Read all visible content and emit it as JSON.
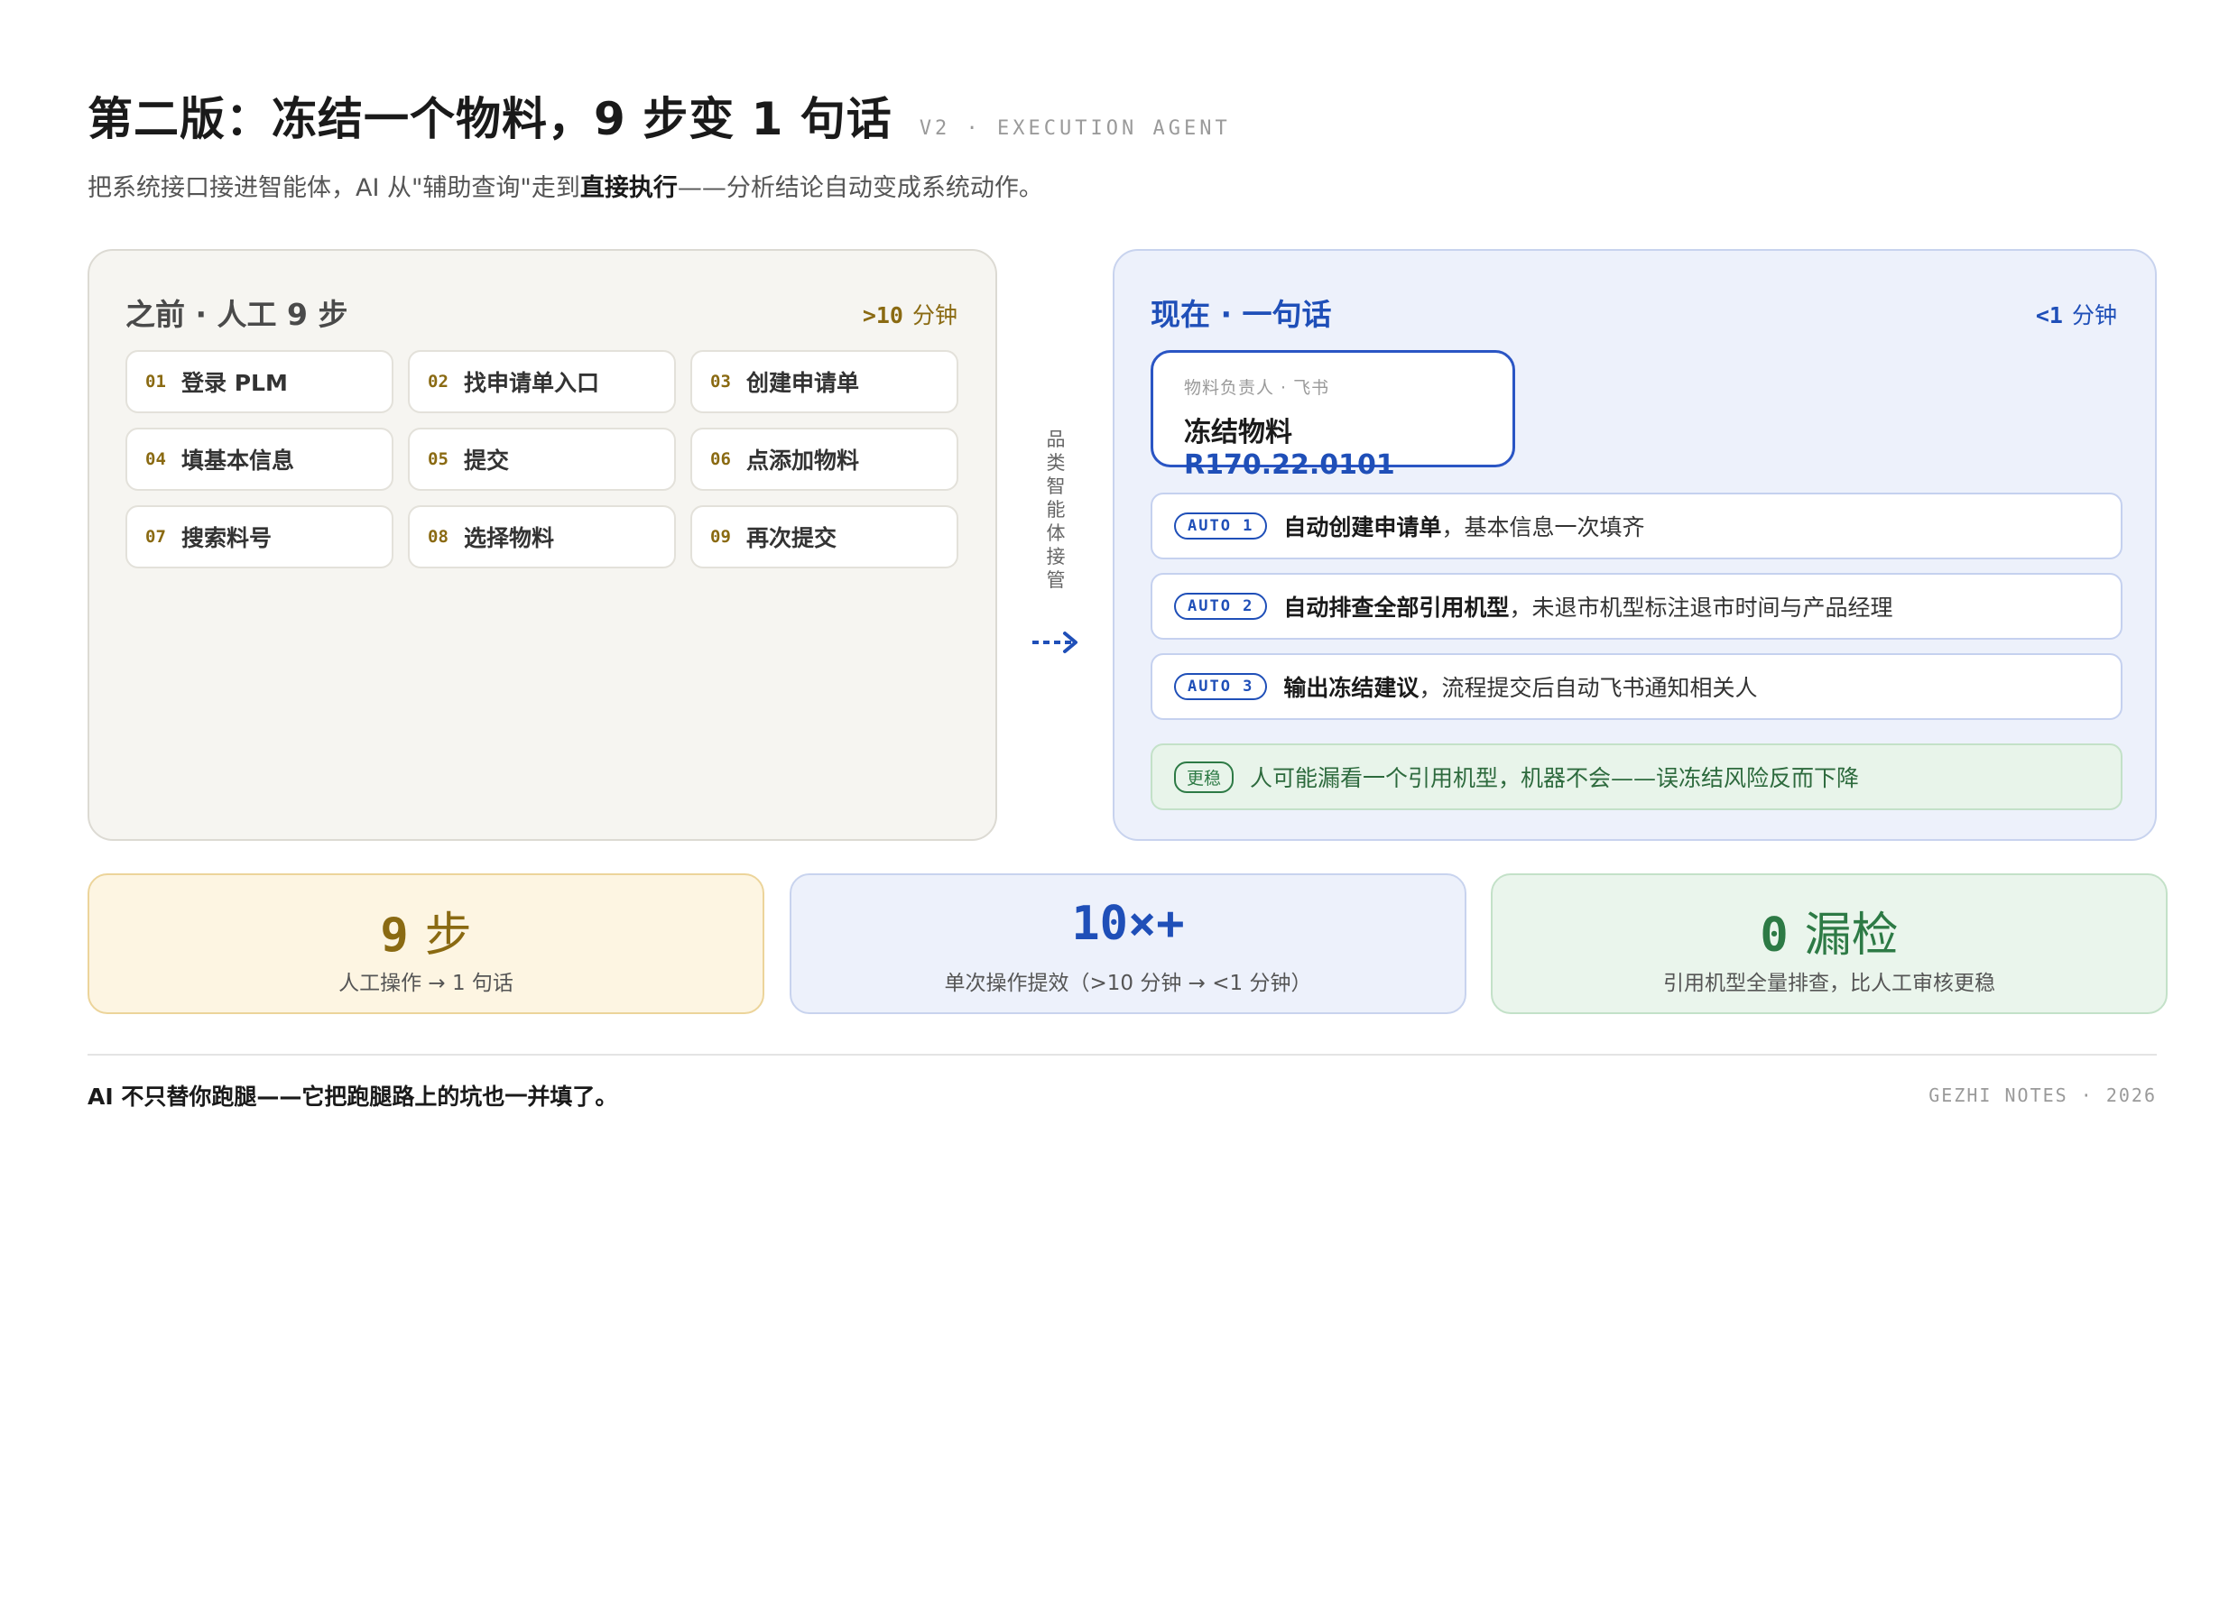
{
  "header": {
    "title": "第二版：冻结一个物料，9 步变 1 句话",
    "tag": "V2 · EXECUTION AGENT",
    "subtitle_pre": "把系统接口接进智能体，AI 从\"辅助查询\"走到",
    "subtitle_bold": "直接执行",
    "subtitle_post": "——分析结论自动变成系统动作。"
  },
  "before": {
    "heading": "之前 · 人工 9 步",
    "time_value": ">10",
    "time_unit": "分钟",
    "steps": [
      {
        "num": "01",
        "label": "登录 PLM"
      },
      {
        "num": "02",
        "label": "找申请单入口"
      },
      {
        "num": "03",
        "label": "创建申请单"
      },
      {
        "num": "04",
        "label": "填基本信息"
      },
      {
        "num": "05",
        "label": "提交"
      },
      {
        "num": "06",
        "label": "点添加物料"
      },
      {
        "num": "07",
        "label": "搜索料号"
      },
      {
        "num": "08",
        "label": "选择物料"
      },
      {
        "num": "09",
        "label": "再次提交"
      }
    ]
  },
  "connector": {
    "text": "品类智能体接管",
    "chars": [
      "品",
      "类",
      "智",
      "能",
      "体",
      "接",
      "管"
    ]
  },
  "now": {
    "heading": "现在 · 一句话",
    "time_value": "<1",
    "time_unit": "分钟",
    "command": {
      "meta": "物料负责人 · 飞书",
      "action": "冻结物料",
      "code": "R170.22.0101"
    },
    "autos": [
      {
        "badge": "AUTO 1",
        "bold": "自动创建申请单",
        "rest": "，基本信息一次填齐"
      },
      {
        "badge": "AUTO 2",
        "bold": "自动排查全部引用机型",
        "rest": "，未退市机型标注退市时间与产品经理"
      },
      {
        "badge": "AUTO 3",
        "bold": "输出冻结建议",
        "rest": "，流程提交后自动飞书通知相关人"
      }
    ],
    "stable": {
      "badge": "更稳",
      "text": "人可能漏看一个引用机型，机器不会——误冻结风险反而下降"
    }
  },
  "stats": [
    {
      "value": "9",
      "value_cjk": "步",
      "desc": "人工操作 → 1 句话",
      "color": "#8a6a12"
    },
    {
      "value": "10×+",
      "value_cjk": "",
      "desc": "单次操作提效（>10 分钟 → <1 分钟）",
      "color": "#1f4fb8"
    },
    {
      "value": "0",
      "value_cjk": "漏检",
      "desc": "引用机型全量排查，比人工审核更稳",
      "color": "#2d7a45"
    }
  ],
  "footer": {
    "left_pre": "AI 不只替你跑腿——",
    "left_post": "它把跑腿路上的坑也一并填了。",
    "right": "GEZHI NOTES · 2026"
  },
  "colors": {
    "accent_blue": "#1f4fb8",
    "accent_gold": "#8a6a12",
    "accent_green": "#2d7a45"
  }
}
